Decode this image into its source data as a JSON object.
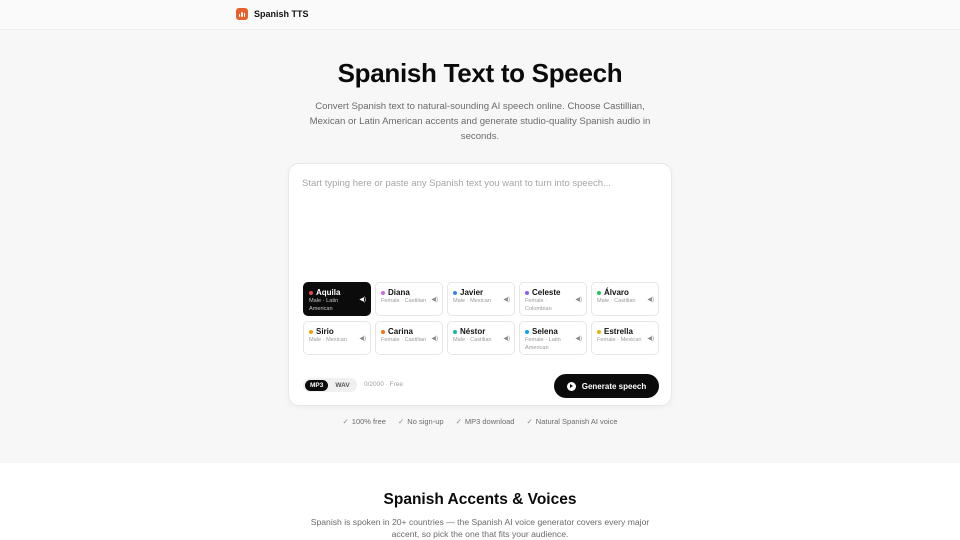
{
  "nav": {
    "brand": "Spanish TTS"
  },
  "hero": {
    "title": "Spanish Text to Speech",
    "subtitle": "Convert Spanish text to natural-sounding AI speech online. Choose Castillian, Mexican or Latin American accents and generate studio-quality Spanish audio in seconds."
  },
  "editor": {
    "placeholder": "Start typing here or paste any Spanish text you want to turn into speech...",
    "counter": "0/2000 · Free",
    "formats": [
      "MP3",
      "WAV"
    ],
    "selected_format": "MP3",
    "generate_label": "Generate speech"
  },
  "voices": [
    {
      "name": "Aquila",
      "meta": "Male · Latin American",
      "color": "#e5484d",
      "selected": true
    },
    {
      "name": "Diana",
      "meta": "Female · Castilian",
      "color": "#c86dd7",
      "selected": false
    },
    {
      "name": "Javier",
      "meta": "Male · Mexican",
      "color": "#3b82f6",
      "selected": false
    },
    {
      "name": "Celeste",
      "meta": "Female · Colombian",
      "color": "#8b5cf6",
      "selected": false
    },
    {
      "name": "Álvaro",
      "meta": "Male · Castilian",
      "color": "#22c55e",
      "selected": false
    },
    {
      "name": "Sirio",
      "meta": "Male · Mexican",
      "color": "#f59e0b",
      "selected": false
    },
    {
      "name": "Carina",
      "meta": "Female · Castilian",
      "color": "#f97316",
      "selected": false
    },
    {
      "name": "Néstor",
      "meta": "Male · Castilian",
      "color": "#14b8a6",
      "selected": false
    },
    {
      "name": "Selena",
      "meta": "Female · Latin American",
      "color": "#0ea5e9",
      "selected": false
    },
    {
      "name": "Estrella",
      "meta": "Female · Mexican",
      "color": "#eab308",
      "selected": false
    }
  ],
  "features": [
    "100% free",
    "No sign-up",
    "MP3 download",
    "Natural Spanish AI voice"
  ],
  "accents_section": {
    "title": "Spanish Accents & Voices",
    "subtitle": "Spanish is spoken in 20+ countries — the Spanish AI voice generator covers every major accent, so pick the one that fits your audience."
  }
}
